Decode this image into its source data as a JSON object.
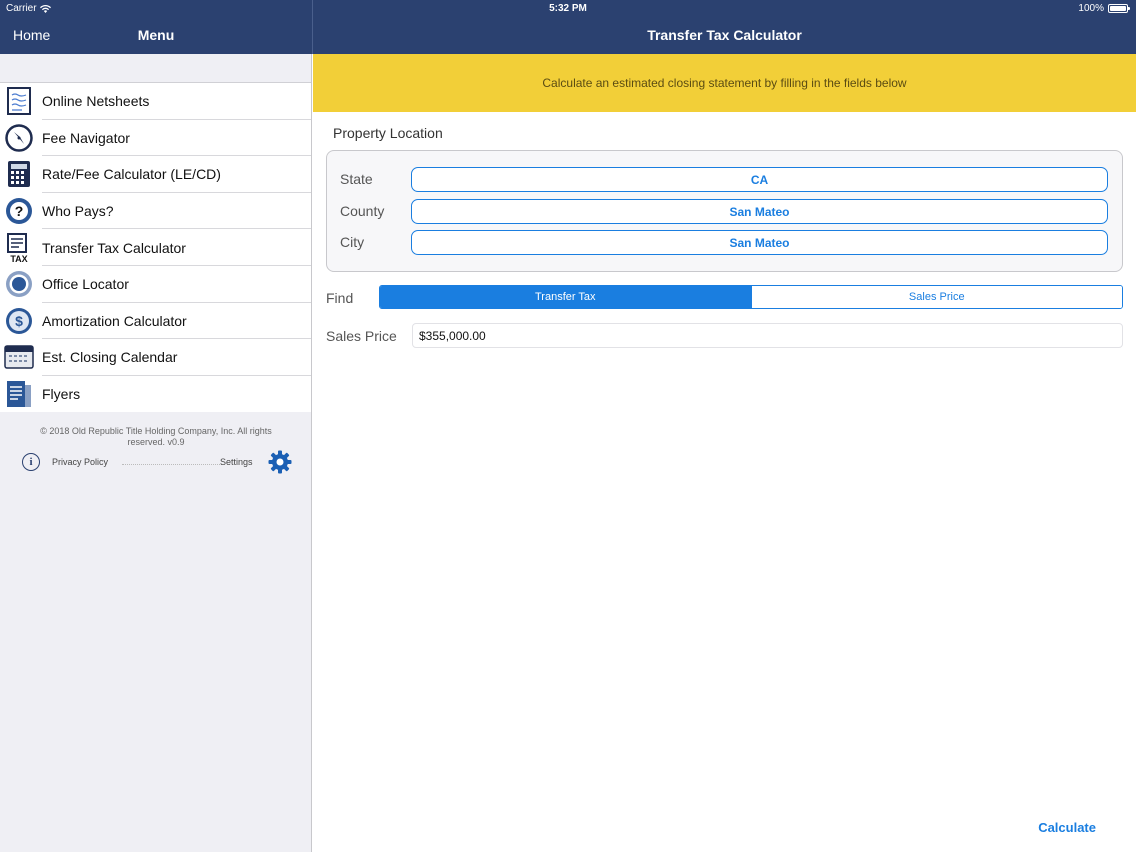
{
  "status_bar": {
    "carrier": "Carrier",
    "time": "5:32 PM",
    "battery": "100%"
  },
  "nav": {
    "home_label": "Home",
    "menu_title": "Menu",
    "page_title": "Transfer Tax Calculator"
  },
  "sidebar": {
    "items": [
      {
        "label": "Online Netsheets",
        "icon": "netsheet-icon"
      },
      {
        "label": "Fee Navigator",
        "icon": "compass-icon"
      },
      {
        "label": "Rate/Fee Calculator (LE/CD)",
        "icon": "calculator-icon"
      },
      {
        "label": "Who Pays?",
        "icon": "question-icon"
      },
      {
        "label": "Transfer Tax Calculator",
        "icon": "tax-icon"
      },
      {
        "label": "Office Locator",
        "icon": "location-icon"
      },
      {
        "label": "Amortization Calculator",
        "icon": "dollar-icon"
      },
      {
        "label": "Est. Closing Calendar",
        "icon": "calendar-icon"
      },
      {
        "label": "Flyers",
        "icon": "flyer-icon"
      }
    ],
    "copyright": "© 2018 Old Republic Title Holding Company, Inc. All rights reserved. v0.9",
    "privacy_label": "Privacy Policy",
    "settings_label": "Settings"
  },
  "main": {
    "banner": "Calculate an estimated closing statement by filling in the fields below",
    "section_title": "Property Location",
    "location": {
      "state_label": "State",
      "state_value": "CA",
      "county_label": "County",
      "county_value": "San Mateo",
      "city_label": "City",
      "city_value": "San Mateo"
    },
    "find_label": "Find",
    "segments": {
      "transfer_tax": "Transfer Tax",
      "sales_price": "Sales Price",
      "selected": "Transfer Tax"
    },
    "sales_price_label": "Sales Price",
    "sales_price_value": "$355,000.00",
    "calculate_label": "Calculate"
  },
  "colors": {
    "nav_bg": "#2b4170",
    "banner_bg": "#f2cf38",
    "accent": "#1a7ee0",
    "sidebar_bg": "#efeff4"
  }
}
